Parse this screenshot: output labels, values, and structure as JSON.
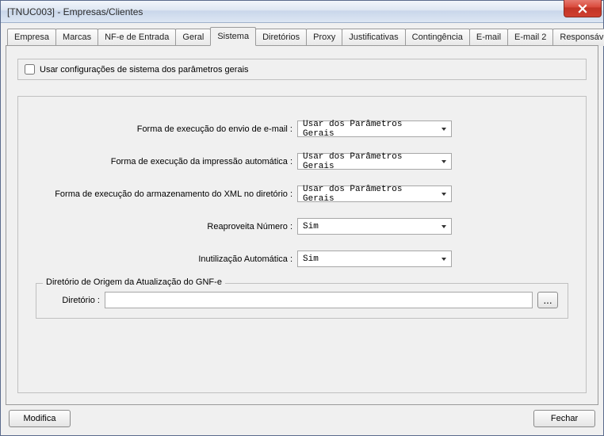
{
  "window": {
    "title": "[TNUC003] - Empresas/Clientes"
  },
  "tabs": [
    {
      "label": "Empresa"
    },
    {
      "label": "Marcas"
    },
    {
      "label": "NF-e de Entrada"
    },
    {
      "label": "Geral"
    },
    {
      "label": "Sistema"
    },
    {
      "label": "Diretórios"
    },
    {
      "label": "Proxy"
    },
    {
      "label": "Justificativas"
    },
    {
      "label": "Contingência"
    },
    {
      "label": "E-mail"
    },
    {
      "label": "E-mail 2"
    },
    {
      "label": "Responsáveis"
    }
  ],
  "systemTab": {
    "useGeneralParams": {
      "label": "Usar configurações de sistema dos parâmetros gerais",
      "checked": false
    },
    "fields": {
      "emailExec": {
        "label": "Forma de execução do envio de e-mail :",
        "value": "Usar dos Parâmetros Gerais"
      },
      "printExec": {
        "label": "Forma de execução da impressão automática :",
        "value": "Usar dos Parâmetros Gerais"
      },
      "xmlStoreExec": {
        "label": "Forma de execução do armazenamento do XML no diretório :",
        "value": "Usar dos Parâmetros Gerais"
      },
      "reuseNumber": {
        "label": "Reaproveita Número :",
        "value": "Sim"
      },
      "autoInutil": {
        "label": "Inutilização Automática :",
        "value": "Sim"
      }
    },
    "dirGroup": {
      "legend": "Diretório de Origem da Atualização do GNF-e",
      "label": "Diretório :",
      "value": "",
      "browse": "..."
    }
  },
  "footer": {
    "modify": "Modifica",
    "close": "Fechar"
  }
}
